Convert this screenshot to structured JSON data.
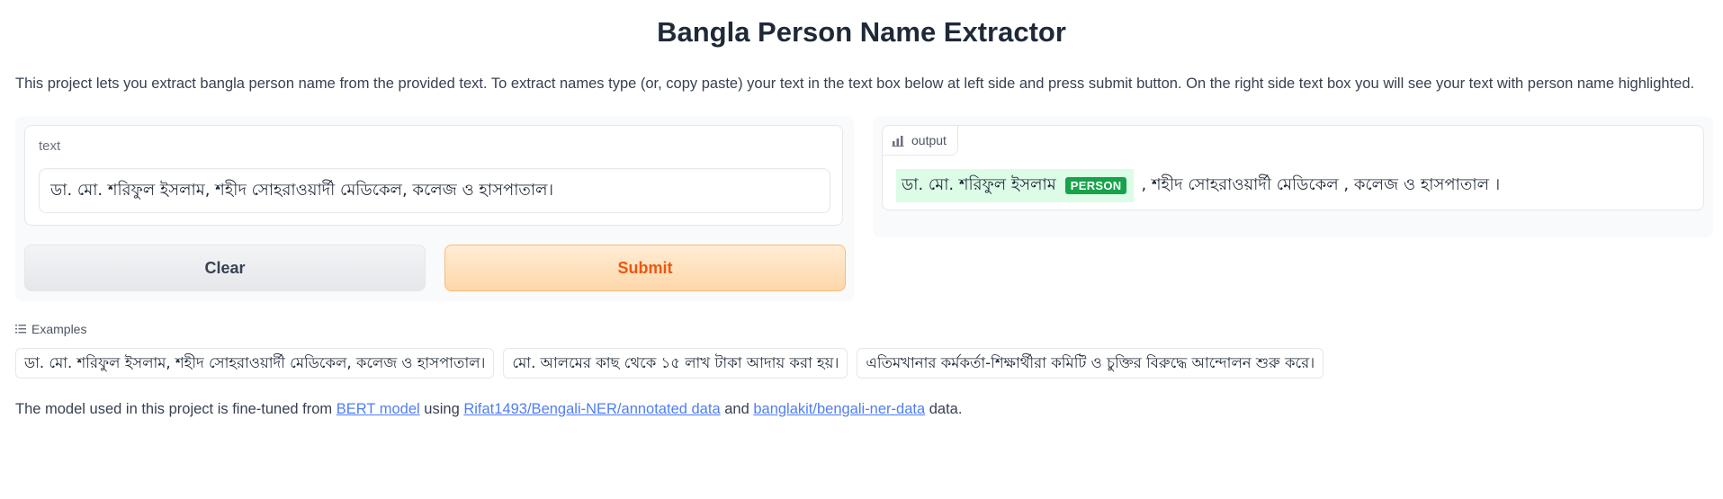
{
  "header": {
    "title": "Bangla Person Name Extractor",
    "description": "This project lets you extract bangla person name from the provided text. To extract names type (or, copy paste) your text in the text box below at left side and press submit button. On the right side text box you will see your text with person name highlighted."
  },
  "input": {
    "label": "text",
    "value": "ডা. মো. শরিফুল ইসলাম, শহীদ সোহরাওয়ার্দী মেডিকেল, কলেজ ও হাসপাতাল।"
  },
  "buttons": {
    "clear_label": "Clear",
    "submit_label": "Submit"
  },
  "output": {
    "label": "output",
    "entity_text": "ডা. মো. শরিফুল ইসলাম",
    "entity_label": "PERSON",
    "rest_text": ", শহীদ সোহরাওয়ার্দী মেডিকেল , কলেজ ও হাসপাতাল ।"
  },
  "examples": {
    "label": "Examples",
    "items": [
      "ডা. মো. শরিফুল ইসলাম, শহীদ সোহরাওয়ার্দী মেডিকেল, কলেজ ও হাসপাতাল।",
      "মো. আলমের কাছ থেকে ১৫ লাখ টাকা আদায় করা হয়।",
      "এতিমখানার কর্মকর্তা-শিক্ষার্থীরা কমিটি ও চুক্তির বিরুদ্ধে আন্দোলন শুরু করে।"
    ]
  },
  "footer": {
    "prefix": "The model used in this project is fine-tuned from",
    "link1": "BERT model",
    "mid1": "using",
    "link2": "Rifat1493/Bengali-NER/annotated data",
    "mid2": "and",
    "link3": "banglakit/bengali-ner-data",
    "suffix": "data."
  },
  "colors": {
    "accent": "#ea580c",
    "entity_bg": "#dcfce7",
    "entity_label_bg": "#16a34a",
    "link": "#4f7ef5"
  }
}
